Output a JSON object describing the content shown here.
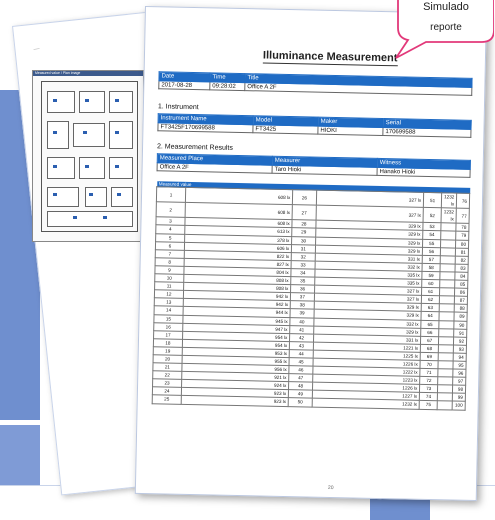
{
  "bubble": {
    "line1": "Simulado",
    "line2": "reporte"
  },
  "back_page": {
    "header": "—",
    "plan_title": "Measured value / Plan image"
  },
  "report": {
    "brand": "",
    "title": "Illuminance Measurement",
    "header_table": {
      "cols": [
        "Date",
        "Time",
        "Title"
      ],
      "values": [
        "2017-08-28",
        "09:28:02",
        "Office A 2F"
      ]
    },
    "instrument": {
      "section": "1. Instrument",
      "cols": [
        "Instrument Name",
        "Model",
        "Maker",
        "Serial"
      ],
      "values": [
        "FT3425F170699588",
        "FT3425",
        "HIOKI",
        "170699588"
      ]
    },
    "results": {
      "section": "2. Measurement Results",
      "cols": [
        "Measured Place",
        "Measurer",
        "Witness"
      ],
      "values": [
        "Office A 2F",
        "Taro Hioki",
        "Hanako Hioki"
      ],
      "measured_value_label": "Measured value"
    },
    "rows": [
      [
        "1",
        "608 lx",
        "26",
        "327 lx",
        "51",
        "1232 lx",
        "76"
      ],
      [
        "2",
        "608 lx",
        "27",
        "327 lx",
        "52",
        "1232 lx",
        "77"
      ],
      [
        "3",
        "608 lx",
        "28",
        "329 lx",
        "53",
        "",
        "78"
      ],
      [
        "4",
        "613 lx",
        "29",
        "329 lx",
        "54",
        "",
        "79"
      ],
      [
        "5",
        "378 lx",
        "30",
        "329 lx",
        "55",
        "",
        "80"
      ],
      [
        "6",
        "606 lx",
        "31",
        "329 lx",
        "56",
        "",
        "81"
      ],
      [
        "7",
        "822 lx",
        "32",
        "331 lx",
        "57",
        "",
        "82"
      ],
      [
        "8",
        "827 lx",
        "33",
        "332 lx",
        "58",
        "",
        "83"
      ],
      [
        "9",
        "804 lx",
        "34",
        "335 lx",
        "59",
        "",
        "84"
      ],
      [
        "10",
        "808 lx",
        "35",
        "335 lx",
        "60",
        "",
        "85"
      ],
      [
        "11",
        "808 lx",
        "36",
        "327 lx",
        "61",
        "",
        "86"
      ],
      [
        "12",
        "942 lx",
        "37",
        "327 lx",
        "62",
        "",
        "87"
      ],
      [
        "13",
        "942 lx",
        "38",
        "329 lx",
        "63",
        "",
        "88"
      ],
      [
        "14",
        "944 lx",
        "39",
        "329 lx",
        "64",
        "",
        "89"
      ],
      [
        "15",
        "945 lx",
        "40",
        "332 lx",
        "65",
        "",
        "90"
      ],
      [
        "16",
        "947 lx",
        "41",
        "329 lx",
        "66",
        "",
        "91"
      ],
      [
        "17",
        "954 lx",
        "42",
        "331 lx",
        "67",
        "",
        "92"
      ],
      [
        "18",
        "954 lx",
        "43",
        "1221 lx",
        "68",
        "",
        "93"
      ],
      [
        "19",
        "953 lx",
        "44",
        "1225 lx",
        "69",
        "",
        "94"
      ],
      [
        "20",
        "955 lx",
        "45",
        "1226 lx",
        "70",
        "",
        "95"
      ],
      [
        "21",
        "956 lx",
        "46",
        "1222 lx",
        "71",
        "",
        "96"
      ],
      [
        "22",
        "921 lx",
        "47",
        "1223 lx",
        "72",
        "",
        "97"
      ],
      [
        "23",
        "924 lx",
        "48",
        "1226 lx",
        "73",
        "",
        "98"
      ],
      [
        "24",
        "923 lx",
        "49",
        "1227 lx",
        "74",
        "",
        "99"
      ],
      [
        "25",
        "923 lx",
        "50",
        "1232 lx",
        "75",
        "",
        "100"
      ]
    ],
    "page_number": "20"
  }
}
